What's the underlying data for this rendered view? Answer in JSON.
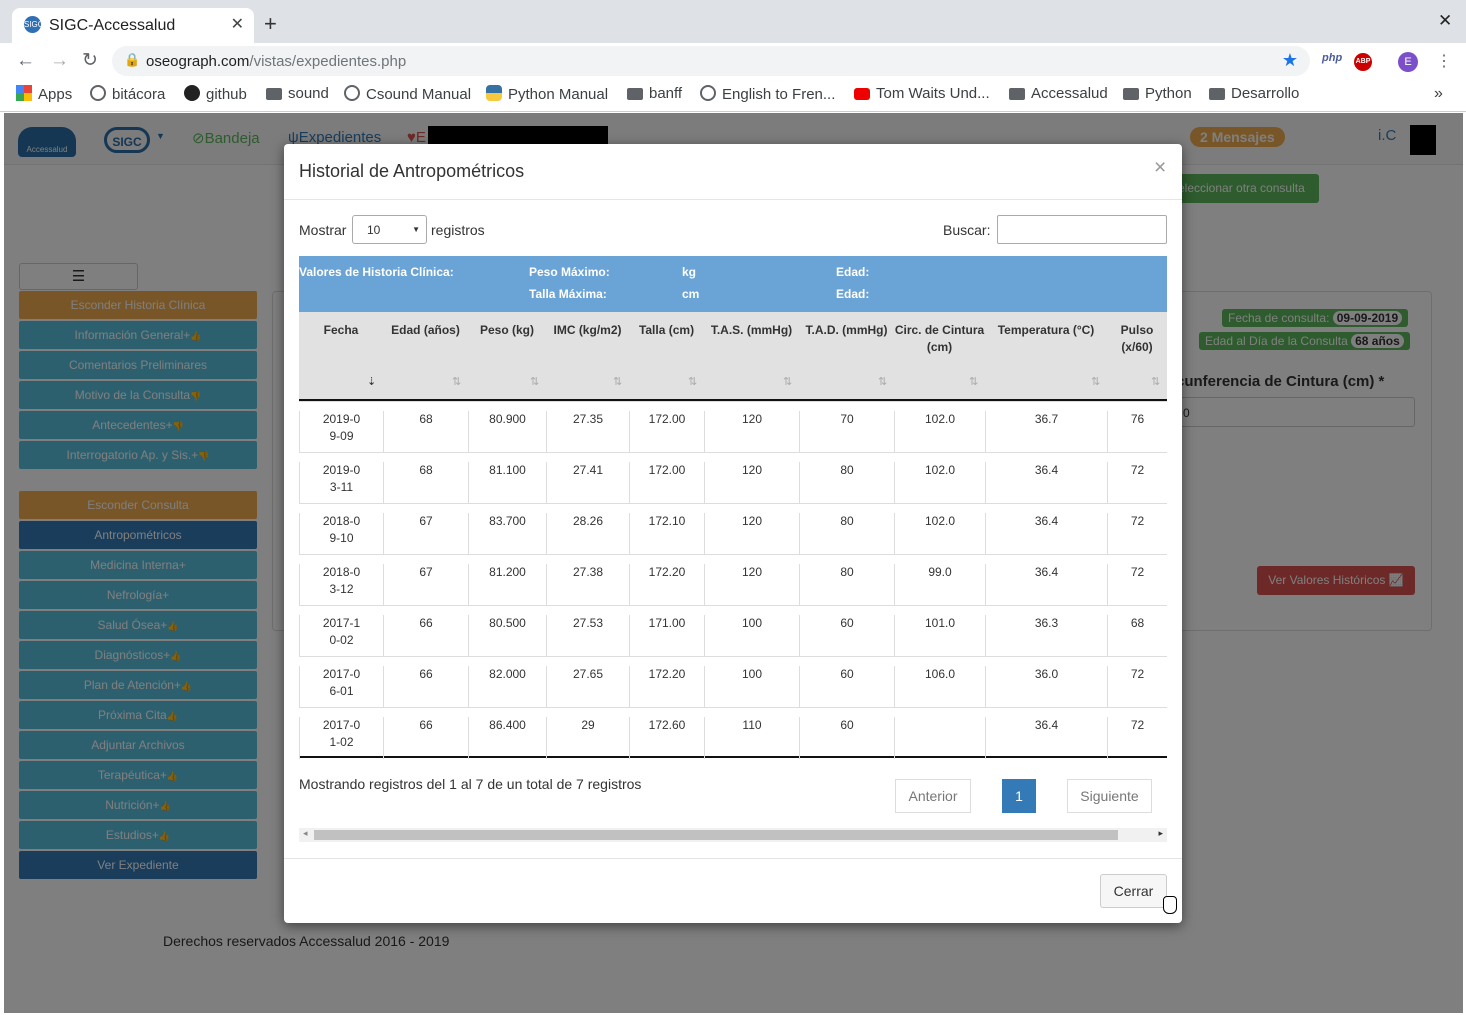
{
  "browser": {
    "tab_title": "SIGC-Accessalud",
    "favicon_text": "SIGC",
    "url_domain": "oseograph.com",
    "url_path": "/vistas/expedientes.php",
    "ext_php": "php",
    "ext_abp": "ABP",
    "profile_initial": "E",
    "bookmarks": [
      "Apps",
      "bitácora",
      "github",
      "sound",
      "Csound Manual",
      "Python Manual",
      "banff",
      "English to Fren...",
      "Tom Waits Und...",
      "Accessalud",
      "Python",
      "Desarrollo"
    ]
  },
  "app": {
    "logo_text": "Accessalud",
    "sigc_text": "SIGC",
    "nav": {
      "bandeja": "Bandeja",
      "expedientes": "Expedientes",
      "third": "E"
    },
    "messages": "2 Mensajes",
    "user": "i.C",
    "select_other": "eleccionar otra consulta",
    "sidebar": [
      "Esconder Historia Clínica",
      "Información General+",
      "Comentarios Preliminares",
      "Motivo de la Consulta",
      "Antecedentes+",
      "Interrogatorio Ap. y Sis.+",
      "Esconder Consulta",
      "Antropométricos",
      "Medicina Interna+",
      "Nefrología+",
      "Salud Ósea+",
      "Diagnósticos+",
      "Plan de Atención+",
      "Próxima Cita",
      "Adjuntar Archivos",
      "Terapéutica+",
      "Nutrición+",
      "Estudios+",
      "Ver Expediente"
    ],
    "fecha_label": "Fecha de consulta:",
    "fecha_value": "09-09-2019",
    "edad_label": "Edad al Día de la Consulta",
    "edad_value": "68 años",
    "circ_label": "cunferencia de Cintura (cm) *",
    "circ_value": "2.0",
    "historicos_btn": "Ver Valores Históricos",
    "footer": "Derechos reservados Accessalud 2016 - 2019"
  },
  "modal": {
    "title": "Historial de Antropométricos",
    "close_x": "×",
    "show_label": "Mostrar",
    "show_value": "10",
    "records_label": "registros",
    "search_label": "Buscar:",
    "info": {
      "valores": "Valores de Historia Clínica:",
      "peso_max": "Peso Máximo:",
      "talla_max": "Talla Máxima:",
      "kg": "kg",
      "cm": "cm",
      "edad1": "Edad:",
      "edad2": "Edad:"
    },
    "headers": [
      "Fecha",
      "Edad (años)",
      "Peso (kg)",
      "IMC (kg/m2)",
      "Talla (cm)",
      "T.A.S. (mmHg)",
      "T.A.D. (mmHg)",
      "Circ. de Cintura (cm)",
      "Temperatura (°C)",
      "Pulso (x/60)"
    ],
    "rows": [
      [
        "2019-09-09",
        "68",
        "80.900",
        "27.35",
        "172.00",
        "120",
        "70",
        "102.0",
        "36.7",
        "76"
      ],
      [
        "2019-03-11",
        "68",
        "81.100",
        "27.41",
        "172.00",
        "120",
        "80",
        "102.0",
        "36.4",
        "72"
      ],
      [
        "2018-09-10",
        "67",
        "83.700",
        "28.26",
        "172.10",
        "120",
        "80",
        "102.0",
        "36.4",
        "72"
      ],
      [
        "2018-03-12",
        "67",
        "81.200",
        "27.38",
        "172.20",
        "120",
        "80",
        "99.0",
        "36.4",
        "72"
      ],
      [
        "2017-10-02",
        "66",
        "80.500",
        "27.53",
        "171.00",
        "100",
        "60",
        "101.0",
        "36.3",
        "68"
      ],
      [
        "2017-06-01",
        "66",
        "82.000",
        "27.65",
        "172.20",
        "100",
        "60",
        "106.0",
        "36.0",
        "72"
      ],
      [
        "2017-01-02",
        "66",
        "86.400",
        "29",
        "172.60",
        "110",
        "60",
        "",
        "36.4",
        "72"
      ]
    ],
    "summary": "Mostrando registros del 1 al 7 de un total de 7 registros",
    "prev": "Anterior",
    "page": "1",
    "next": "Siguiente",
    "close_btn": "Cerrar"
  }
}
